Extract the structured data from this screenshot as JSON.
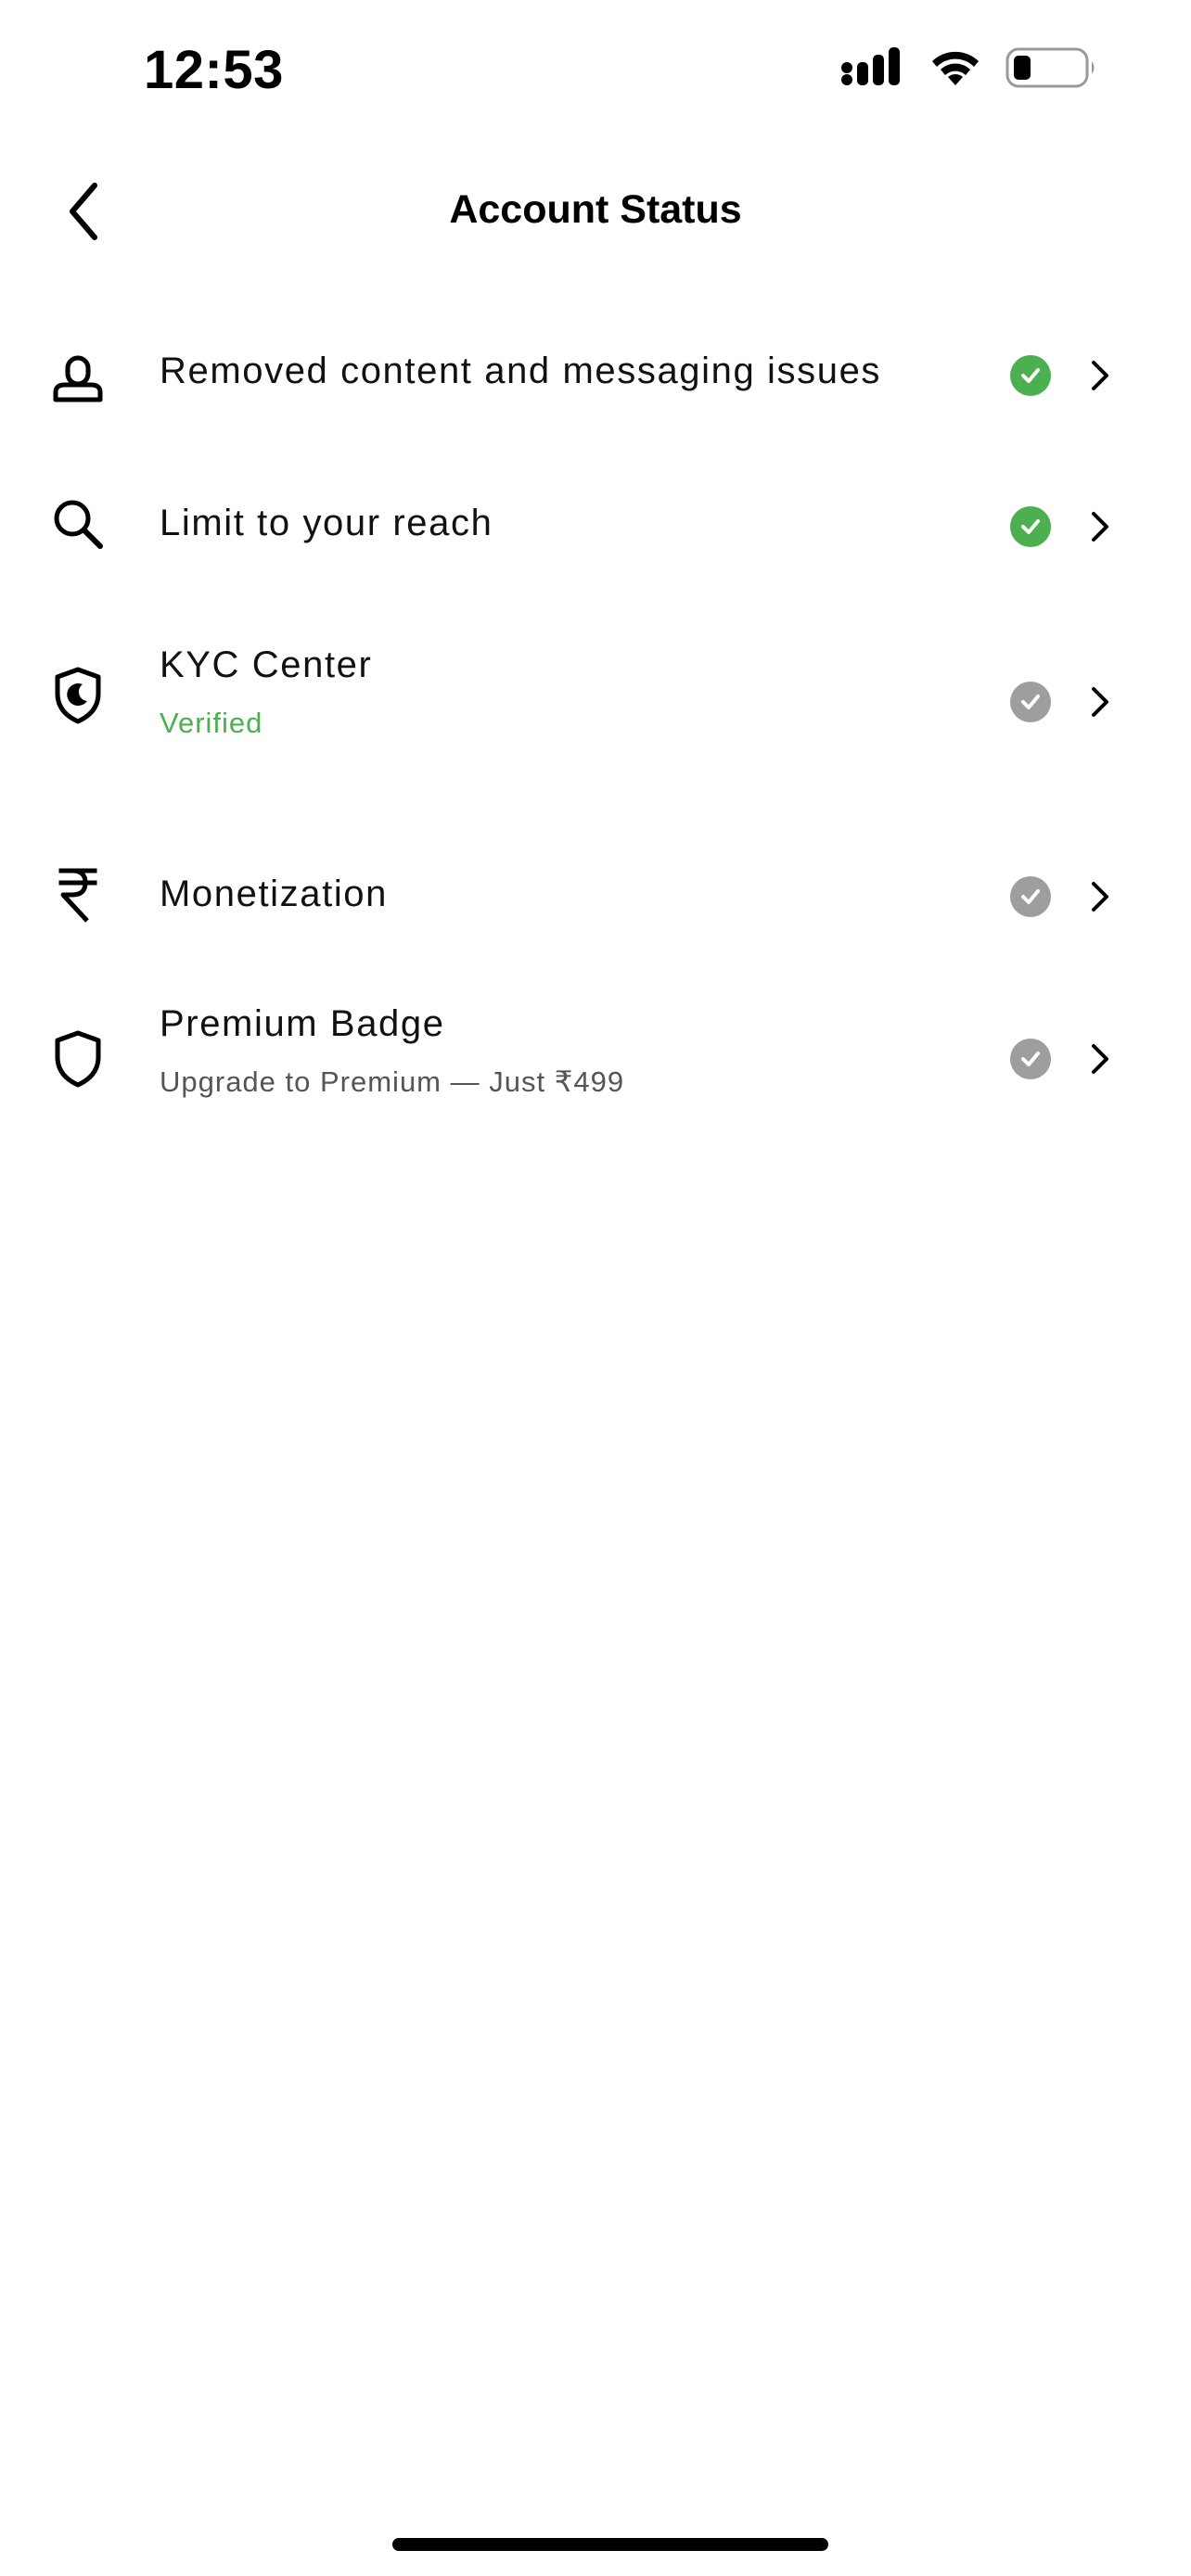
{
  "status_bar": {
    "time": "12:53",
    "icons": [
      "cellular-signal-icon",
      "wifi-icon",
      "battery-icon"
    ],
    "battery_level": 0.25
  },
  "header": {
    "title": "Account Status",
    "back_icon": "chevron-left-icon"
  },
  "rows": [
    {
      "id": "removed-content",
      "title": "Removed content and messaging issues",
      "subtitle": "",
      "icon": "person-icon",
      "status": "green",
      "chevron": "chevron-right-icon"
    },
    {
      "id": "limit-reach",
      "title": "Limit to your reach",
      "subtitle": "",
      "icon": "search-icon",
      "status": "green",
      "chevron": "chevron-right-icon"
    },
    {
      "id": "kyc-center",
      "title": "KYC Center",
      "subtitle": "Verified",
      "icon": "shield-moon-icon",
      "status": "grey",
      "chevron": "chevron-right-icon"
    },
    {
      "id": "monetization",
      "title": "Monetization",
      "subtitle": "",
      "icon": "rupee-icon",
      "status": "grey",
      "chevron": "chevron-right-icon"
    },
    {
      "id": "premium-badge",
      "title": "Premium Badge",
      "subtitle": "Upgrade to Premium — Just ₹499",
      "icon": "shield-outline-icon",
      "status": "grey",
      "chevron": "chevron-right-icon"
    }
  ],
  "colors": {
    "status_green": "#4caf50",
    "status_grey": "#9e9e9e",
    "verified_text": "#4caf50",
    "text_primary": "#111111",
    "text_secondary": "#555555",
    "background": "#ffffff"
  }
}
